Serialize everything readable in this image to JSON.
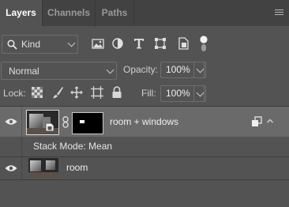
{
  "tabs": [
    {
      "label": "Layers",
      "active": true
    },
    {
      "label": "Channels",
      "active": false
    },
    {
      "label": "Paths",
      "active": false
    }
  ],
  "filter": {
    "kind_label": "Kind",
    "icons": [
      "image-filter-icon",
      "adjustment-filter-icon",
      "type-filter-icon",
      "shape-filter-icon",
      "smart-object-filter-icon",
      "filter-toggle-icon"
    ]
  },
  "blend": {
    "mode": "Normal"
  },
  "opacity": {
    "label": "Opacity:",
    "value": "100%"
  },
  "lock": {
    "label": "Lock:",
    "icons": [
      "lock-transparent-pixels-icon",
      "lock-image-pixels-icon",
      "lock-position-icon",
      "lock-artboard-icon",
      "lock-all-icon"
    ]
  },
  "fill": {
    "label": "Fill:",
    "value": "100%"
  },
  "layers": [
    {
      "name": "room + windows",
      "selected": true,
      "smart_object": true,
      "has_mask": true,
      "stack_mode": "Stack Mode: Mean"
    },
    {
      "name": "room",
      "selected": false,
      "smart_object": false,
      "has_mask": false
    }
  ],
  "colors": {
    "panel_bg": "#535353",
    "tab_bar_bg": "#424242",
    "selected_row_bg": "#6a6a6a"
  }
}
